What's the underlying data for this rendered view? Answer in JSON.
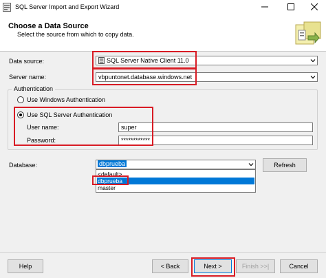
{
  "window": {
    "title": "SQL Server Import and Export Wizard"
  },
  "header": {
    "title": "Choose a Data Source",
    "subtitle": "Select the source from which to copy data."
  },
  "form": {
    "data_source_label": "Data source:",
    "data_source_value": "SQL Server Native Client 11.0",
    "server_name_label": "Server name:",
    "server_name_value": "vbpuntonet.database.windows.net",
    "auth_group_label": "Authentication",
    "windows_auth_label": "Use Windows Authentication",
    "sql_auth_label": "Use SQL Server Authentication",
    "user_name_label": "User name:",
    "user_name_value": "super",
    "password_label": "Password:",
    "password_value": "************",
    "database_label": "Database:",
    "database_value": "dbprueba",
    "database_options": [
      "<default>",
      "dbprueba",
      "master"
    ],
    "refresh_label": "Refresh"
  },
  "buttons": {
    "help": "Help",
    "back": "< Back",
    "next": "Next >",
    "finish": "Finish >>|",
    "cancel": "Cancel"
  },
  "colors": {
    "highlight": "#d81b24",
    "selection": "#0078d7"
  }
}
